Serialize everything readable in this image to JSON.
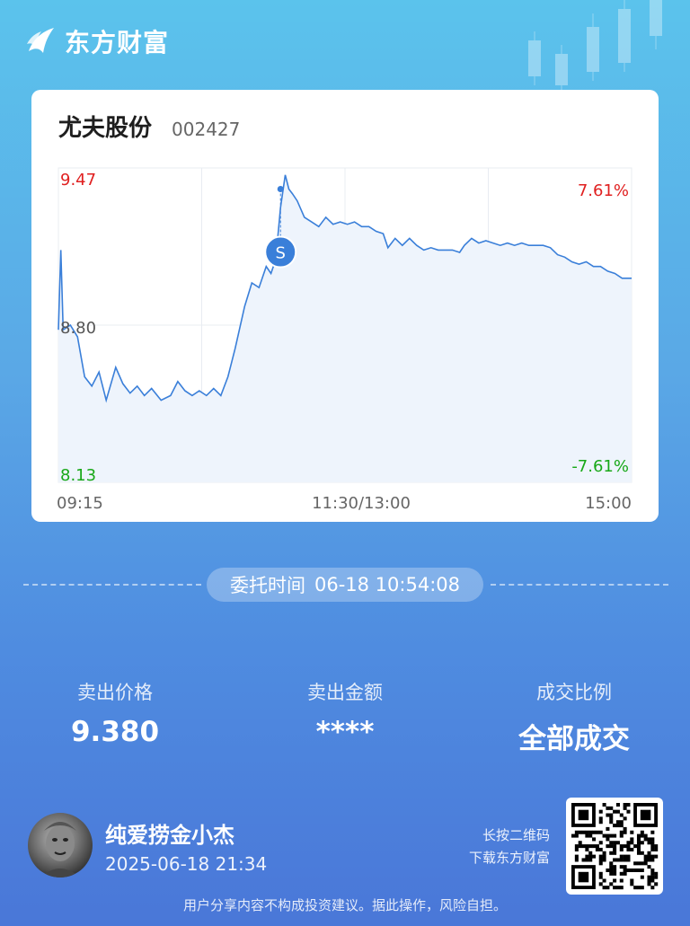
{
  "brand": {
    "name": "东方财富"
  },
  "stock": {
    "name": "尤夫股份",
    "code": "002427"
  },
  "chart_data": {
    "type": "line",
    "y_max_label": "9.47",
    "y_mid_label": "8.80",
    "y_min_label": "8.13",
    "pct_up_label": "7.61%",
    "pct_down_label": "-7.61%",
    "x_labels": [
      "09:15",
      "11:30/13:00",
      "15:00"
    ],
    "ylim": [
      8.13,
      9.47
    ],
    "pre_close": 8.8,
    "x_range": [
      0,
      240
    ],
    "series": [
      {
        "values": [
          [
            0,
            8.78
          ],
          [
            1,
            9.12
          ],
          [
            2,
            8.78
          ],
          [
            5,
            8.8
          ],
          [
            8,
            8.75
          ],
          [
            11,
            8.58
          ],
          [
            14,
            8.54
          ],
          [
            17,
            8.6
          ],
          [
            20,
            8.48
          ],
          [
            24,
            8.62
          ],
          [
            27,
            8.55
          ],
          [
            30,
            8.51
          ],
          [
            33,
            8.54
          ],
          [
            36,
            8.5
          ],
          [
            39,
            8.53
          ],
          [
            43,
            8.48
          ],
          [
            47,
            8.5
          ],
          [
            50,
            8.56
          ],
          [
            53,
            8.52
          ],
          [
            56,
            8.5
          ],
          [
            59,
            8.52
          ],
          [
            62,
            8.5
          ],
          [
            65,
            8.53
          ],
          [
            68,
            8.5
          ],
          [
            71,
            8.58
          ],
          [
            74,
            8.7
          ],
          [
            78,
            8.88
          ],
          [
            81,
            8.98
          ],
          [
            84,
            8.96
          ],
          [
            87,
            9.05
          ],
          [
            89,
            9.02
          ],
          [
            91,
            9.08
          ],
          [
            93,
            9.3
          ],
          [
            95,
            9.44
          ],
          [
            96.5,
            9.38
          ],
          [
            98,
            9.36
          ],
          [
            100,
            9.33
          ],
          [
            103,
            9.26
          ],
          [
            106,
            9.24
          ],
          [
            109,
            9.22
          ],
          [
            112,
            9.26
          ],
          [
            115,
            9.23
          ],
          [
            118,
            9.24
          ],
          [
            121,
            9.23
          ],
          [
            124,
            9.24
          ],
          [
            127,
            9.22
          ],
          [
            130,
            9.22
          ],
          [
            133,
            9.2
          ],
          [
            136,
            9.19
          ],
          [
            138,
            9.13
          ],
          [
            141,
            9.17
          ],
          [
            144,
            9.14
          ],
          [
            147,
            9.17
          ],
          [
            150,
            9.14
          ],
          [
            153,
            9.12
          ],
          [
            156,
            9.13
          ],
          [
            159,
            9.12
          ],
          [
            162,
            9.12
          ],
          [
            165,
            9.12
          ],
          [
            168,
            9.11
          ],
          [
            170,
            9.14
          ],
          [
            173,
            9.17
          ],
          [
            176,
            9.15
          ],
          [
            179,
            9.16
          ],
          [
            182,
            9.15
          ],
          [
            185,
            9.14
          ],
          [
            188,
            9.15
          ],
          [
            191,
            9.14
          ],
          [
            194,
            9.15
          ],
          [
            197,
            9.14
          ],
          [
            200,
            9.14
          ],
          [
            203,
            9.14
          ],
          [
            206,
            9.13
          ],
          [
            209,
            9.1
          ],
          [
            212,
            9.09
          ],
          [
            215,
            9.07
          ],
          [
            218,
            9.06
          ],
          [
            221,
            9.07
          ],
          [
            224,
            9.05
          ],
          [
            227,
            9.05
          ],
          [
            230,
            9.03
          ],
          [
            233,
            9.02
          ],
          [
            236,
            9.0
          ],
          [
            240,
            9.0
          ]
        ]
      }
    ],
    "marker": {
      "x": 93,
      "y": 9.38,
      "label": "S"
    }
  },
  "order": {
    "time_label": "委托时间",
    "time_value": "06-18 10:54:08"
  },
  "stats": [
    {
      "label": "卖出价格",
      "value": "9.380"
    },
    {
      "label": "卖出金额",
      "value": "****"
    },
    {
      "label": "成交比例",
      "value": "全部成交"
    }
  ],
  "user": {
    "name": "纯爱捞金小杰",
    "time": "2025-06-18 21:34"
  },
  "qr": {
    "hint_line1": "长按二维码",
    "hint_line2": "下载东方财富"
  },
  "disclaimer": "用户分享内容不构成投资建议。据此操作，风险自担。",
  "colors": {
    "up": "#e02020",
    "down": "#18a818",
    "line": "#3a7fd9",
    "marker": "#3a7fd9"
  }
}
